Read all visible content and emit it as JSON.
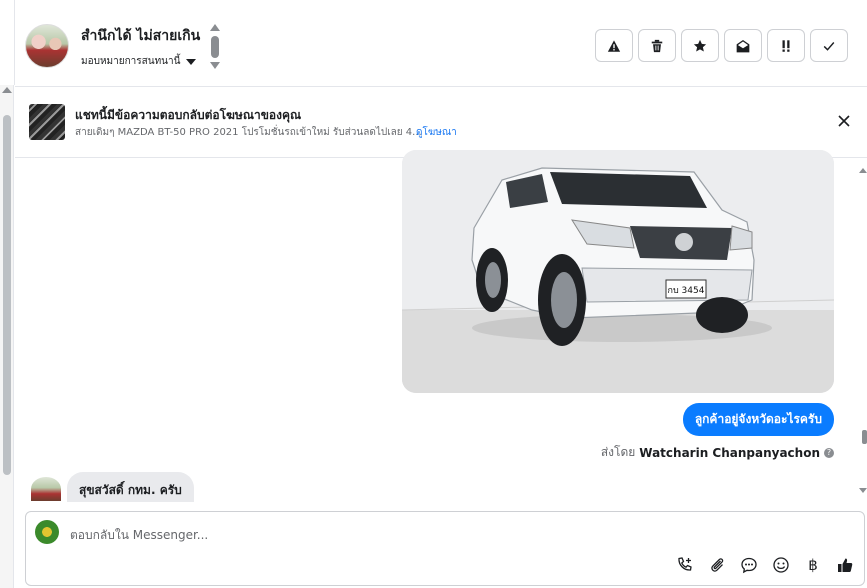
{
  "header": {
    "contact_name": "สำนึกได้ ไม่สายเกิน",
    "assign_label": "มอบหมายการสนทนานี้",
    "actions": [
      {
        "name": "spam",
        "icon": "warning-icon"
      },
      {
        "name": "delete",
        "icon": "trash-icon"
      },
      {
        "name": "star",
        "icon": "star-icon"
      },
      {
        "name": "mark-unread",
        "icon": "envelope-open-icon"
      },
      {
        "name": "follow-up",
        "icon": "exclamation-icon"
      },
      {
        "name": "done",
        "icon": "check-icon"
      }
    ]
  },
  "ad_banner": {
    "title": "แชทนี้มีข้อความตอบกลับต่อโฆษณาของคุณ",
    "subtitle": "สายเดิมๆ MAZDA BT-50 PRO 2021 โปรโมชั่นรถเข้าใหม่ รับส่วนลดไปเลย 4...",
    "link": "ดูโฆษณา"
  },
  "conversation": {
    "car_photo_plate": "กบ 3454",
    "outgoing_message": "ลูกค้าอยู่จังหวัดอะไรครับ",
    "sent_by_prefix": "ส่งโดย",
    "sent_by_name": "Watcharin Chanpanyachon",
    "incoming_message": "สุขสวัสดิ์  กทม. ครับ"
  },
  "composer": {
    "placeholder": "ตอบกลับใน Messenger...",
    "currency_symbol": "฿"
  }
}
